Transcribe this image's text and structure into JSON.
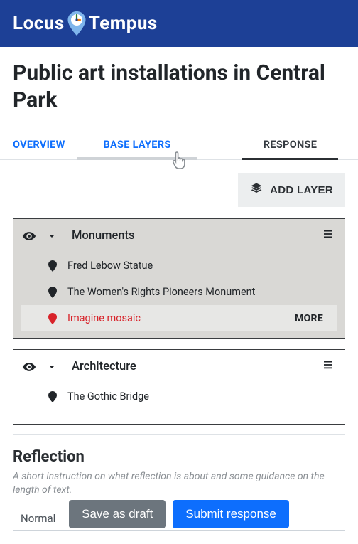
{
  "brand": {
    "name_left": "Locus",
    "name_right": "Tempus"
  },
  "page": {
    "title": "Public art installations in Central Park"
  },
  "tabs": {
    "overview": "OVERVIEW",
    "base_layers": "BASE LAYERS",
    "response": "RESPONSE"
  },
  "actions": {
    "add_layer": "ADD LAYER",
    "save_draft": "Save as draft",
    "submit": "Submit response",
    "more": "MORE"
  },
  "layers": [
    {
      "title": "Monuments",
      "items": [
        {
          "label": "Fred Lebow Statue",
          "selected": false
        },
        {
          "label": "The Women's Rights Pioneers Monument",
          "selected": false
        },
        {
          "label": "Imagine mosaic",
          "selected": true
        }
      ]
    },
    {
      "title": "Architecture",
      "items": [
        {
          "label": "The Gothic Bridge",
          "selected": false
        }
      ]
    }
  ],
  "reflection": {
    "heading": "Reflection",
    "hint": "A short instruction on what reflection is about and some guidance on the length of text.",
    "format_label": "Normal"
  }
}
